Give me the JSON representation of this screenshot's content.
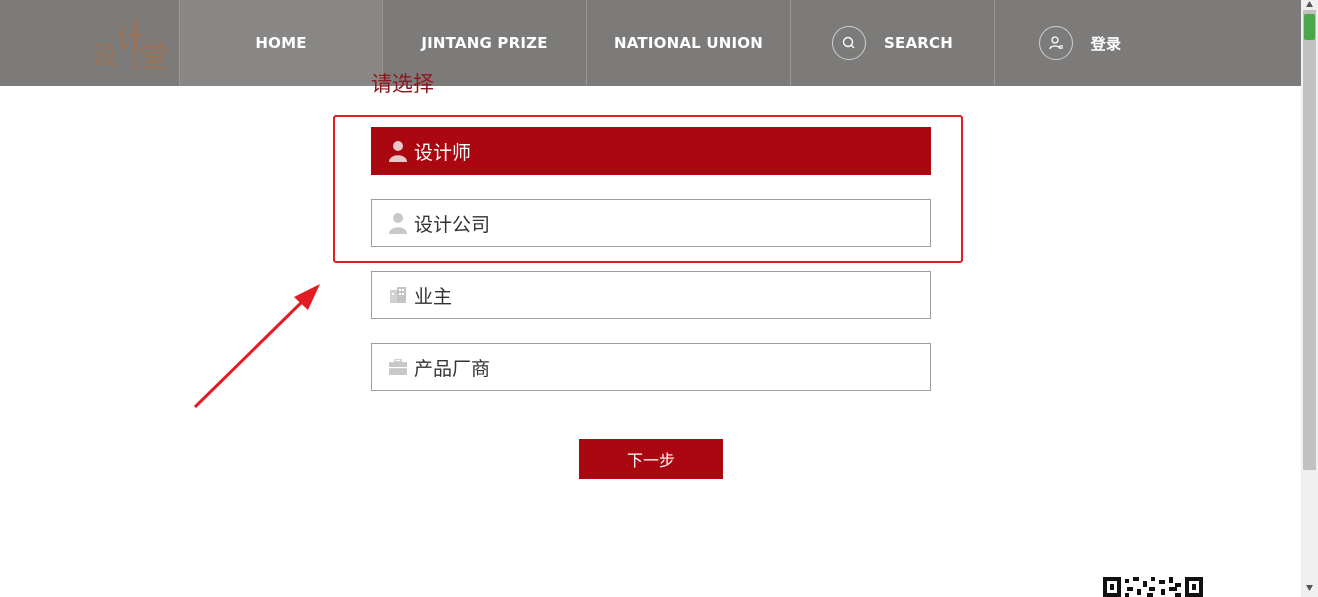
{
  "nav": {
    "logo_chars": [
      "设",
      "计",
      "堂"
    ],
    "home": "HOME",
    "prize": "JINTANG PRIZE",
    "union": "NATIONAL UNION",
    "search": "SEARCH",
    "login": "登录"
  },
  "main": {
    "heading": "请选择",
    "options": [
      {
        "label": "设计师",
        "icon": "person-icon",
        "selected": true
      },
      {
        "label": "设计公司",
        "icon": "person-icon",
        "selected": false
      },
      {
        "label": "业主",
        "icon": "building-icon",
        "selected": false
      },
      {
        "label": "产品厂商",
        "icon": "briefcase-icon",
        "selected": false
      }
    ],
    "next_label": "下一步"
  },
  "colors": {
    "nav_bg": "#7c7b7a",
    "accent": "#ab0710",
    "heading": "#8e1820",
    "annotation": "#e31b23"
  }
}
